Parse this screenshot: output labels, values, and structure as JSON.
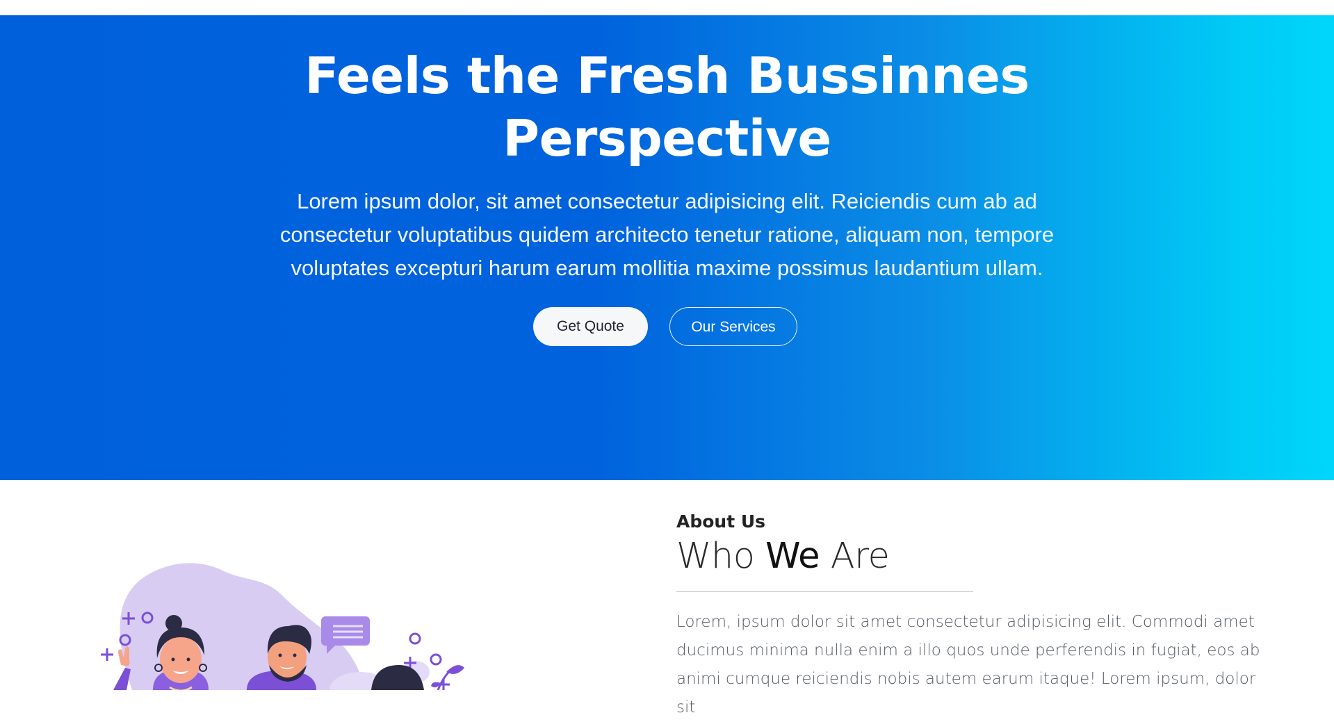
{
  "hero": {
    "title_line1": "Feels the Fresh Bussinnes",
    "title_line2": "Perspective",
    "text_line1": "Lorem ipsum dolor, sit amet consectetur adipisicing elit. Reiciendis cum ab ad",
    "text_line2": "consectetur voluptatibus quidem architecto tenetur ratione, aliquam non, tempore",
    "text_line3": "voluptates excepturi harum earum mollitia maxime possimus laudantium ullam.",
    "primary_button": "Get Quote",
    "secondary_button": "Our Services",
    "gradient_start": "#0060db",
    "gradient_end": "#00d6fb"
  },
  "about": {
    "eyebrow": "About Us",
    "heading_part1": "Who ",
    "heading_emphasis": "We",
    "heading_part2": " Are",
    "text_line1": "Lorem, ipsum dolor sit amet consectetur adipisicing elit. Commodi amet",
    "text_line2": "ducimus minima nulla enim a illo quos unde perferendis in fugiat, eos ab",
    "text_line3": "animi cumque reiciendis nobis autem earum itaque! Lorem ipsum, dolor sit",
    "illustration_icon": "team-illustration",
    "accent_color": "#7b4fd6"
  }
}
